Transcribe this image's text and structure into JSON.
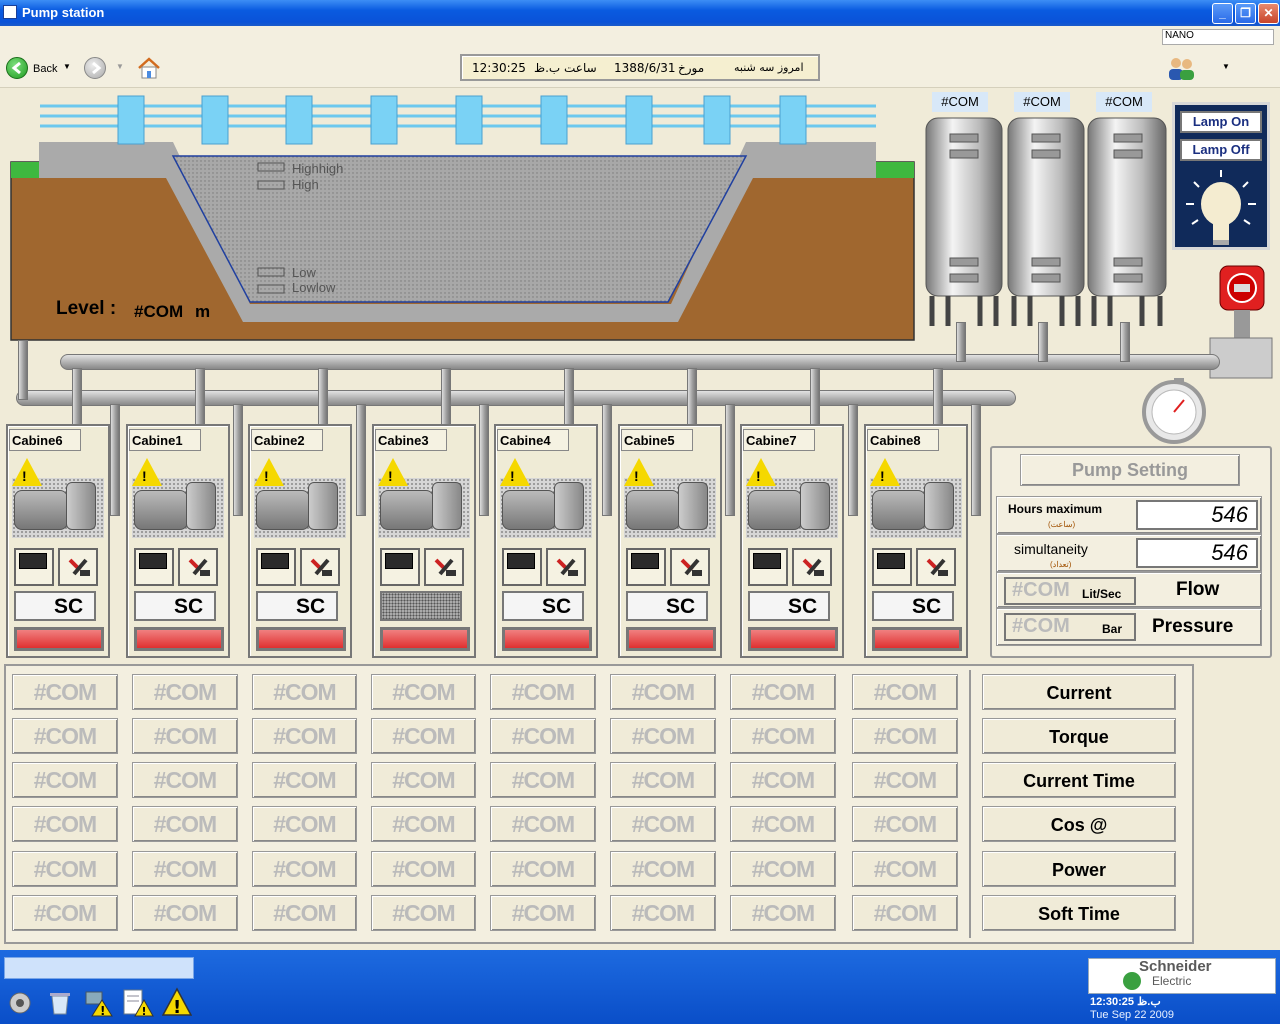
{
  "window": {
    "title": "Pump station",
    "controls": [
      "_",
      "❐",
      "✕"
    ]
  },
  "nav": {
    "back_label": "Back",
    "user_field": "NANO",
    "date_line": {
      "time": "12:30:25",
      "time_suffix": "ساعت ب.ظ",
      "date": "1388/6/31",
      "date_label": "مورخ",
      "day": "امروز سه شنبه"
    }
  },
  "reservoir": {
    "labels": [
      "Highhigh",
      "High",
      "Low",
      "Lowlow"
    ],
    "level_label": "Level :",
    "level_value": "#COM",
    "level_unit": "m"
  },
  "tanks": [
    "#COM",
    "#COM",
    "#COM"
  ],
  "lamp": {
    "on_label": "Lamp On",
    "off_label": "Lamp Off"
  },
  "cabinets": [
    {
      "name": "Cabine6",
      "mode": "SC"
    },
    {
      "name": "Cabine1",
      "mode": "SC"
    },
    {
      "name": "Cabine2",
      "mode": "SC"
    },
    {
      "name": "Cabine3",
      "mode": ""
    },
    {
      "name": "Cabine4",
      "mode": "SC"
    },
    {
      "name": "Cabine5",
      "mode": "SC"
    },
    {
      "name": "Cabine7",
      "mode": "SC"
    },
    {
      "name": "Cabine8",
      "mode": "SC"
    }
  ],
  "pump_setting": {
    "title": "Pump Setting",
    "hours_label": "Hours maximum",
    "hours_sub": "(ساعت)",
    "hours_value": "546",
    "sim_label": "simultaneity",
    "sim_sub": "(تعداد)",
    "sim_value": "546",
    "flow_value": "#COM",
    "flow_unit": "Lit/Sec",
    "flow_label": "Flow",
    "pressure_value": "#COM",
    "pressure_unit": "Bar",
    "pressure_label": "Pressure"
  },
  "grid": {
    "cell_value": "#COM",
    "rows": [
      "Current",
      "Torque",
      "Current Time",
      "Cos @",
      "Power",
      "Soft Time"
    ]
  },
  "taskbar": {
    "brand_line1": "Schneider",
    "brand_line2": "Electric",
    "clock_time": "12:30:25 ب.ظ",
    "clock_date": "Tue Sep 22 2009"
  },
  "colors": {
    "titlebar": "#0a5be0",
    "ground": "#a0672f",
    "water": "#a8a8a8",
    "grass": "#3fb83f",
    "alarm_bar": "#e03030",
    "lamp_panel": "#102a5a",
    "taskbar": "#0a4ec8"
  }
}
